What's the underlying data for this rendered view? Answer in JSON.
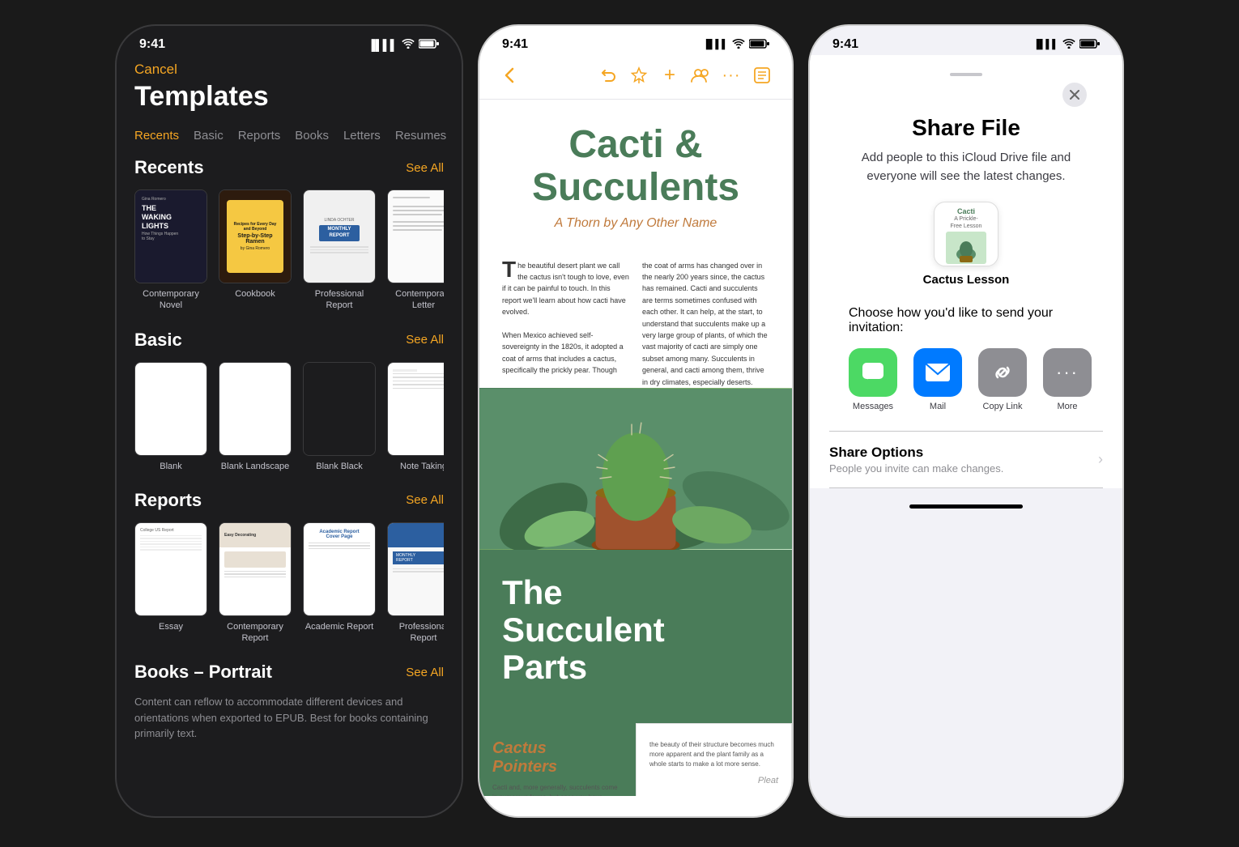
{
  "phone1": {
    "statusBar": {
      "time": "9:41",
      "signal": "●●●●",
      "wifi": "WiFi",
      "battery": "Battery"
    },
    "cancelLabel": "Cancel",
    "titleLabel": "Templates",
    "navItems": [
      {
        "label": "Recents",
        "active": true
      },
      {
        "label": "Basic",
        "active": false
      },
      {
        "label": "Reports",
        "active": false
      },
      {
        "label": "Books",
        "active": false
      },
      {
        "label": "Letters",
        "active": false
      },
      {
        "label": "Resumes",
        "active": false
      }
    ],
    "sections": [
      {
        "title": "Recents",
        "seeAllLabel": "See All",
        "templates": [
          {
            "label": "Contemporary\nNovel"
          },
          {
            "label": "Cookbook"
          },
          {
            "label": "Professional\nReport"
          },
          {
            "label": "Contemporary\nLetter"
          }
        ]
      },
      {
        "title": "Basic",
        "seeAllLabel": "See All",
        "templates": [
          {
            "label": "Blank"
          },
          {
            "label": "Blank Landscape"
          },
          {
            "label": "Blank Black"
          },
          {
            "label": "Note Taking"
          }
        ]
      },
      {
        "title": "Reports",
        "seeAllLabel": "See All",
        "templates": [
          {
            "label": "Essay"
          },
          {
            "label": "Contemporary\nReport"
          },
          {
            "label": "Academic Report"
          },
          {
            "label": "Professional\nReport"
          }
        ]
      },
      {
        "title": "Books – Portrait",
        "seeAllLabel": "See All",
        "description": "Content can reflow to accommodate different devices and orientations when exported to EPUB. Best for books containing primarily text."
      }
    ]
  },
  "phone2": {
    "statusBar": {
      "time": "9:41"
    },
    "toolbar": {
      "backIcon": "‹",
      "icons": [
        "↩",
        "📌",
        "+",
        "👥",
        "···",
        "📋"
      ]
    },
    "document": {
      "title": "Cacti &\nSucculents",
      "subtitle": "A Thorn by Any Other Name",
      "bodyText1": "The beautiful desert plant we call the cactus isn't tough to love, even if it can be painful to touch. In this report we'll learn about how cacti have evolved.",
      "bodyText2": "When Mexico achieved self-sovereignty in the 1820s, it adopted a coat of arms that includes a cactus, specifically the prickly pear. Though",
      "bodyText3": "the coat of arms has changed over in the nearly 200 years since, the cactus has remained. Cacti and succulents are terms sometimes confused with each other. It can help, at the start, to understand that succulents make up a very large group of plants, of which the vast majority of cacti are simply one subset among many. Succulents in general, and cacti among them, thrive in dry climates, especially deserts.",
      "greenTitle": "The\nSucculent\nParts",
      "cardLeftTitle": "Cactus\nPointers",
      "cardLeftText": "Cacti and, more generally, succulents come in numerous forms, but once you have learned to appreciate that cacti prickles are really just very sharp leaves,",
      "pleat": "Pleat"
    }
  },
  "phone3": {
    "statusBar": {
      "time": "9:41"
    },
    "title": "Share File",
    "description": "Add people to this iCloud Drive file and everyone will see the latest changes.",
    "filePreview": {
      "topText": "Cacti",
      "subText": "A Prickle-\nFree Lesson",
      "fileName": "Cactus Lesson"
    },
    "sharePrompt": "Choose how you'd like to send your invitation:",
    "shareOptions": [
      {
        "icon": "💬",
        "label": "Messages",
        "color": "messages"
      },
      {
        "icon": "✉️",
        "label": "Mail",
        "color": "mail"
      },
      {
        "icon": "🔗",
        "label": "Copy Link",
        "color": "copylink"
      },
      {
        "icon": "···",
        "label": "More",
        "color": "more"
      }
    ],
    "shareOptionsSection": {
      "title": "Share Options",
      "subtitle": "People you invite can make changes.",
      "chevron": "›"
    }
  }
}
